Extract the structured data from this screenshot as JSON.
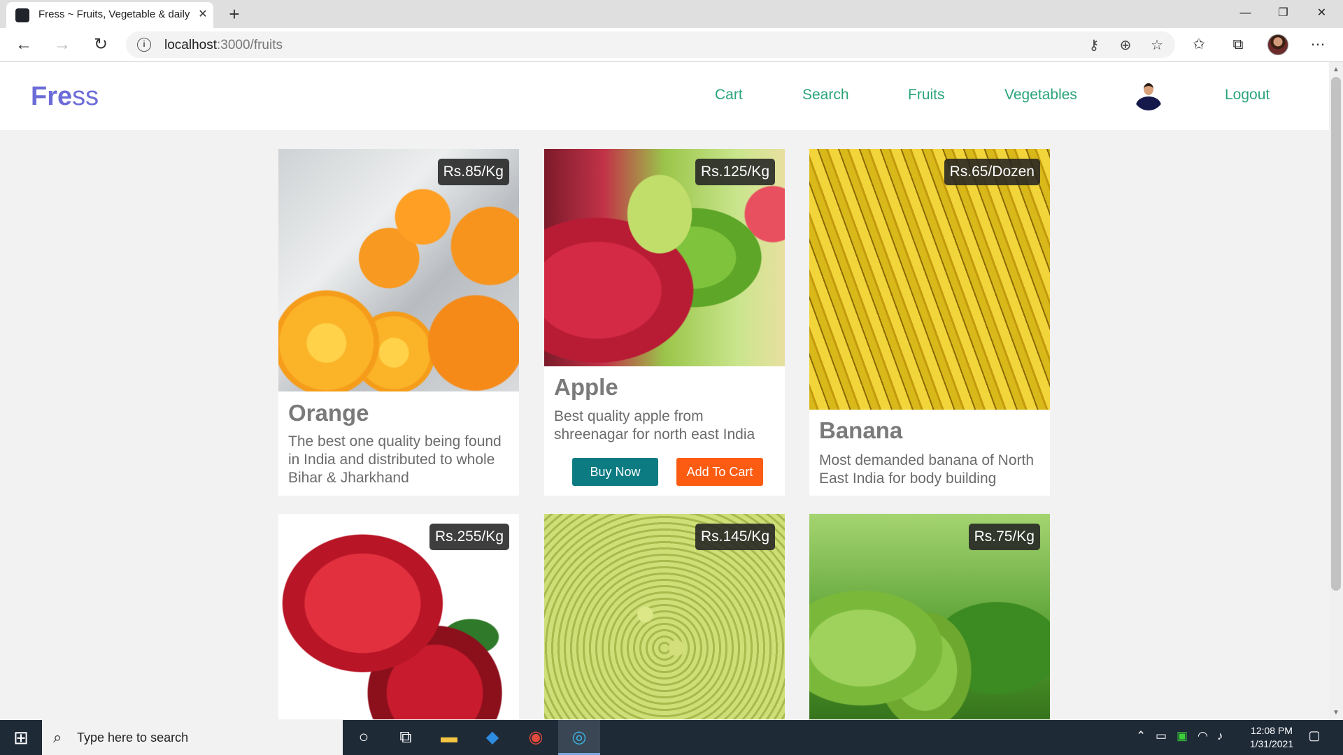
{
  "browser": {
    "tab_title": "Fress ~ Fruits, Vegetable & daily",
    "tab_close": "✕",
    "new_tab": "+",
    "url_host": "localhost",
    "url_path": ":3000/fruits",
    "window_controls": [
      "—",
      "❐",
      "✕"
    ]
  },
  "site": {
    "logo_bold": "Fre",
    "logo_light": "ss",
    "nav": {
      "cart": "Cart",
      "search": "Search",
      "fruits": "Fruits",
      "vegetables": "Vegetables",
      "logout": "Logout"
    },
    "colors": {
      "logo": "#6c6cd8",
      "nav_link": "#2aa579",
      "buy_button": "#0c7b82",
      "cart_button": "#fb5c12"
    }
  },
  "products": [
    {
      "name": "Orange",
      "price": "Rs.85/Kg",
      "description": "The best one quality being found in India and distributed to whole Bihar & Jharkhand",
      "image": "orange"
    },
    {
      "name": "Apple",
      "price": "Rs.125/Kg",
      "description": "Best quality apple from shreenagar for north east India",
      "image": "apple",
      "buy_label": "Buy Now",
      "cart_label": "Add To Cart"
    },
    {
      "name": "Banana",
      "price": "Rs.65/Dozen",
      "description": "Most demanded banana of North East India for body building",
      "image": "banana"
    },
    {
      "name": "",
      "price": "Rs.255/Kg",
      "description": "",
      "image": "pomegranate"
    },
    {
      "name": "",
      "price": "Rs.145/Kg",
      "description": "",
      "image": "grapes"
    },
    {
      "name": "",
      "price": "Rs.75/Kg",
      "description": "",
      "image": "guava"
    }
  ],
  "taskbar": {
    "search_placeholder": "Type here to search",
    "time": "12:08 PM",
    "date": "1/31/2021"
  }
}
